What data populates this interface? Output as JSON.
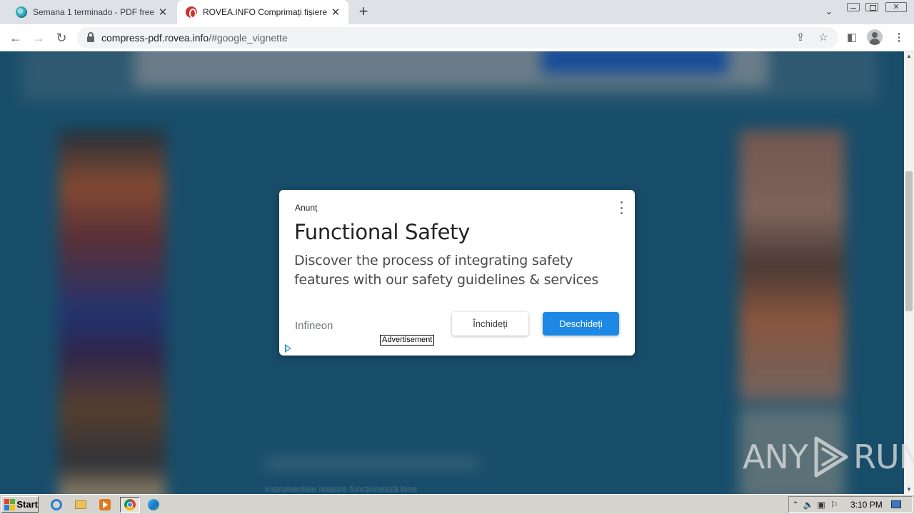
{
  "browser": {
    "tabs": [
      {
        "title": "Semana 1 terminado - PDF free",
        "active": false
      },
      {
        "title": "ROVEA.INFO Comprimați fișiere PDF",
        "active": true
      }
    ],
    "new_tab_symbol": "+",
    "url_host": "compress-pdf.rovea.info",
    "url_rest": "/#google_vignette",
    "icons": [
      "back-icon",
      "forward-icon",
      "reload-icon",
      "lock-icon",
      "share-icon",
      "star-icon",
      "sidepanel-icon",
      "profile-icon",
      "kebab-menu-icon",
      "tab-search-icon",
      "minimize-icon",
      "maximize-icon",
      "close-window-icon"
    ]
  },
  "page": {
    "footer_text": "instrumentele noastre funcționează bine"
  },
  "ad": {
    "label": "Anunț",
    "title": "Functional Safety",
    "description": "Discover the process of integrating safety features with our safety guidelines & services",
    "brand": "Infineon",
    "close_button": "Închideți",
    "open_button": "Deschideți",
    "tag": "Advertisement",
    "colors": {
      "primary": "#1e88e5"
    }
  },
  "watermark": {
    "left": "ANY",
    "right": "RUN"
  },
  "taskbar": {
    "start_label": "Start",
    "clock": "3:10 PM",
    "apps": [
      "ie-icon",
      "folder-icon",
      "media-player-icon",
      "chrome-icon",
      "edge-icon"
    ]
  }
}
